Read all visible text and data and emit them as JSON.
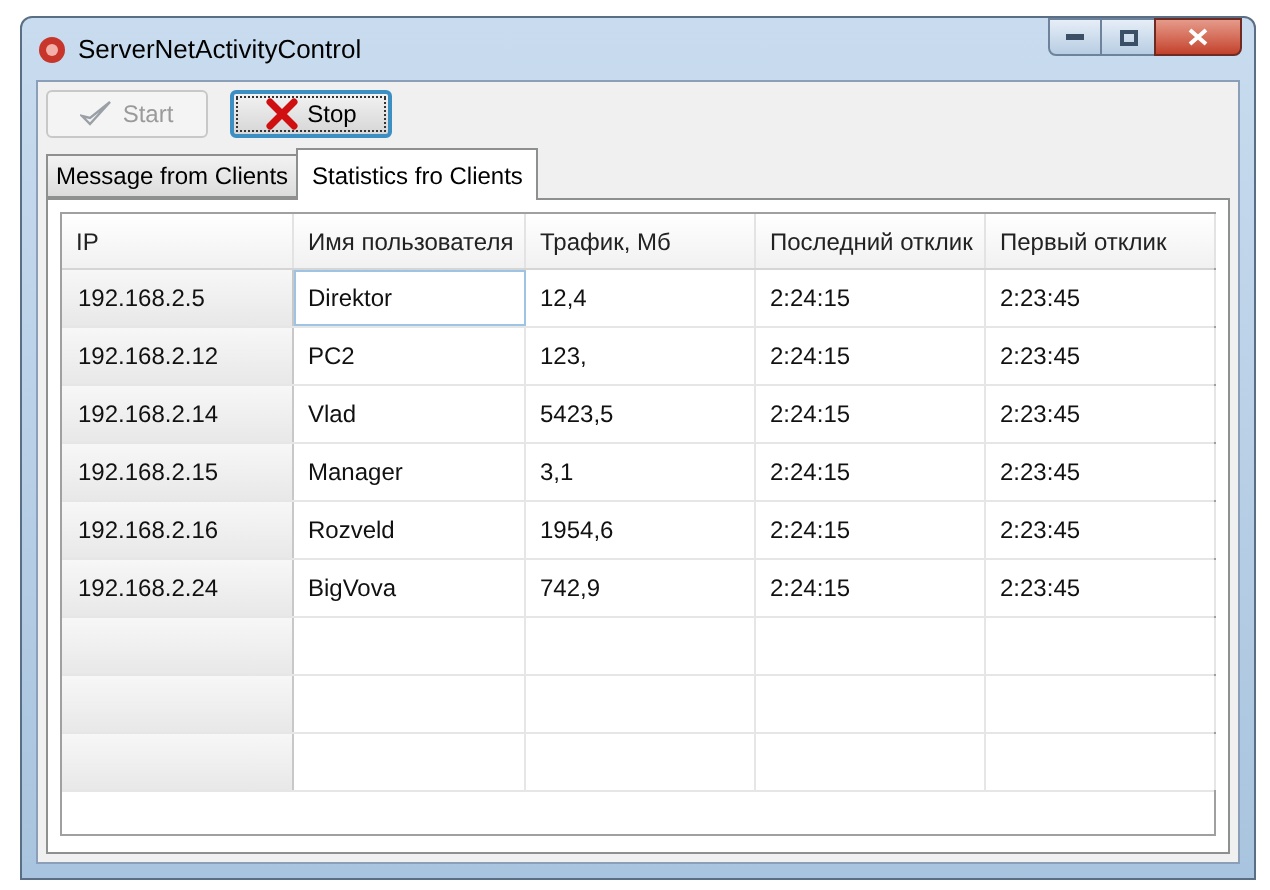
{
  "window": {
    "title": "ServerNetActivityControl"
  },
  "toolbar": [
    {
      "kind": "start",
      "label": "Start",
      "disabled": true
    },
    {
      "kind": "stop",
      "label": "Stop",
      "disabled": false
    }
  ],
  "tabs": [
    {
      "label": "Message from Clients",
      "selected": false
    },
    {
      "label": "Statistics fro Clients",
      "selected": true
    }
  ],
  "table": {
    "columns": [
      "IP",
      "Имя пользователя",
      "Трафик, Мб",
      "Последний отклик",
      "Первый отклик"
    ],
    "rows": [
      {
        "selected": true,
        "cells": [
          "192.168.2.5",
          "Direktor",
          "12,4",
          "2:24:15",
          "2:23:45"
        ]
      },
      {
        "selected": false,
        "cells": [
          "192.168.2.12",
          "PC2",
          "123,",
          "2:24:15",
          "2:23:45"
        ]
      },
      {
        "selected": false,
        "cells": [
          "192.168.2.14",
          "Vlad",
          "5423,5",
          "2:24:15",
          "2:23:45"
        ]
      },
      {
        "selected": false,
        "cells": [
          "192.168.2.15",
          "Manager",
          "3,1",
          "2:24:15",
          "2:23:45"
        ]
      },
      {
        "selected": false,
        "cells": [
          "192.168.2.16",
          "Rozveld",
          "1954,6",
          "2:24:15",
          "2:23:45"
        ]
      },
      {
        "selected": false,
        "cells": [
          "192.168.2.24",
          "BigVova",
          "742,9",
          "2:24:15",
          "2:23:45"
        ]
      }
    ]
  }
}
